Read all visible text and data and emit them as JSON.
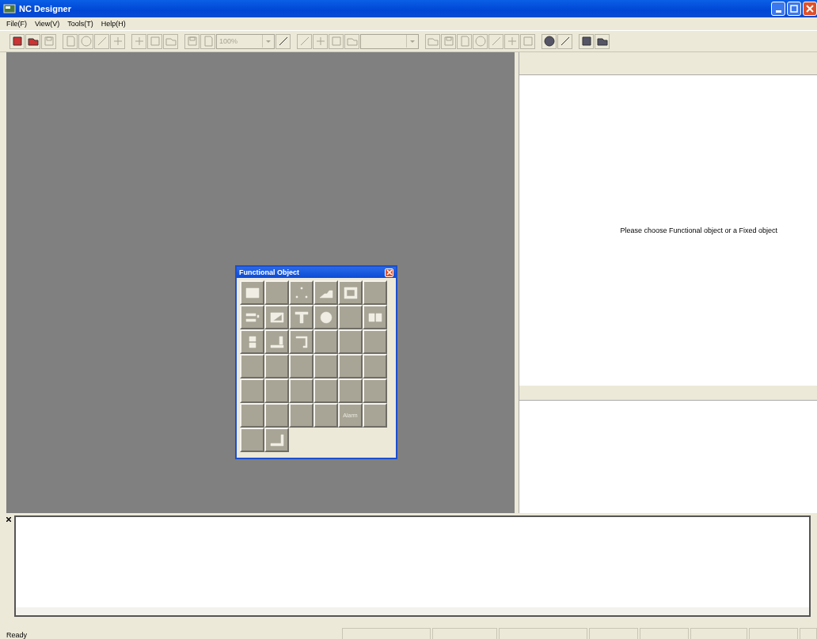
{
  "window": {
    "title": "NC Designer"
  },
  "menu": [
    {
      "label": "File(F)"
    },
    {
      "label": "View(V)"
    },
    {
      "label": "Tools(T)"
    },
    {
      "label": "Help(H)"
    }
  ],
  "toolbar": {
    "groups": [
      [
        {
          "kind": "button",
          "disabled": false
        },
        {
          "kind": "button",
          "disabled": false
        },
        {
          "kind": "button",
          "disabled": true
        }
      ],
      [
        {
          "kind": "button",
          "disabled": true
        },
        {
          "kind": "button",
          "disabled": true
        },
        {
          "kind": "button",
          "disabled": true
        },
        {
          "kind": "button",
          "disabled": true
        }
      ],
      [
        {
          "kind": "button",
          "disabled": true
        },
        {
          "kind": "button",
          "disabled": true
        },
        {
          "kind": "button",
          "disabled": true
        }
      ],
      [
        {
          "kind": "button",
          "disabled": true
        },
        {
          "kind": "button",
          "disabled": true
        },
        {
          "kind": "combo",
          "value": "100%",
          "disabled": true
        },
        {
          "kind": "button",
          "disabled": false
        }
      ],
      [
        {
          "kind": "button",
          "disabled": true
        },
        {
          "kind": "button",
          "disabled": true
        },
        {
          "kind": "button",
          "disabled": true
        },
        {
          "kind": "button",
          "disabled": true
        },
        {
          "kind": "combo",
          "disabled": true
        }
      ],
      [
        {
          "kind": "button",
          "disabled": true
        },
        {
          "kind": "button",
          "disabled": true
        },
        {
          "kind": "button",
          "disabled": true
        },
        {
          "kind": "button",
          "disabled": true
        },
        {
          "kind": "button",
          "disabled": true
        },
        {
          "kind": "button",
          "disabled": true
        },
        {
          "kind": "button",
          "disabled": true
        }
      ],
      [
        {
          "kind": "button",
          "disabled": false
        },
        {
          "kind": "button",
          "disabled": false
        }
      ],
      [
        {
          "kind": "button",
          "disabled": false
        },
        {
          "kind": "button",
          "disabled": false
        }
      ]
    ]
  },
  "properties": {
    "message": "Please choose Functional object or a Fixed object"
  },
  "palette": {
    "title": "Functional Object",
    "buttons": [
      {
        "kind": "icon"
      },
      {
        "kind": "blank"
      },
      {
        "kind": "icon"
      },
      {
        "kind": "icon"
      },
      {
        "kind": "icon"
      },
      {
        "kind": "blank"
      },
      {
        "kind": "icon"
      },
      {
        "kind": "icon"
      },
      {
        "kind": "icon"
      },
      {
        "kind": "icon"
      },
      {
        "kind": "blank"
      },
      {
        "kind": "icon"
      },
      {
        "kind": "icon"
      },
      {
        "kind": "icon"
      },
      {
        "kind": "icon"
      },
      {
        "kind": "blank"
      },
      {
        "kind": "blank"
      },
      {
        "kind": "blank"
      },
      {
        "kind": "blank"
      },
      {
        "kind": "blank"
      },
      {
        "kind": "blank"
      },
      {
        "kind": "blank"
      },
      {
        "kind": "blank"
      },
      {
        "kind": "blank"
      },
      {
        "kind": "blank"
      },
      {
        "kind": "blank"
      },
      {
        "kind": "blank"
      },
      {
        "kind": "blank"
      },
      {
        "kind": "blank"
      },
      {
        "kind": "blank"
      },
      {
        "kind": "blank"
      },
      {
        "kind": "blank"
      },
      {
        "kind": "blank"
      },
      {
        "kind": "blank"
      },
      {
        "kind": "text",
        "label": "Alarm"
      },
      {
        "kind": "blank"
      },
      {
        "kind": "blank"
      },
      {
        "kind": "icon"
      }
    ]
  },
  "status_bar": {
    "text": "Ready"
  }
}
